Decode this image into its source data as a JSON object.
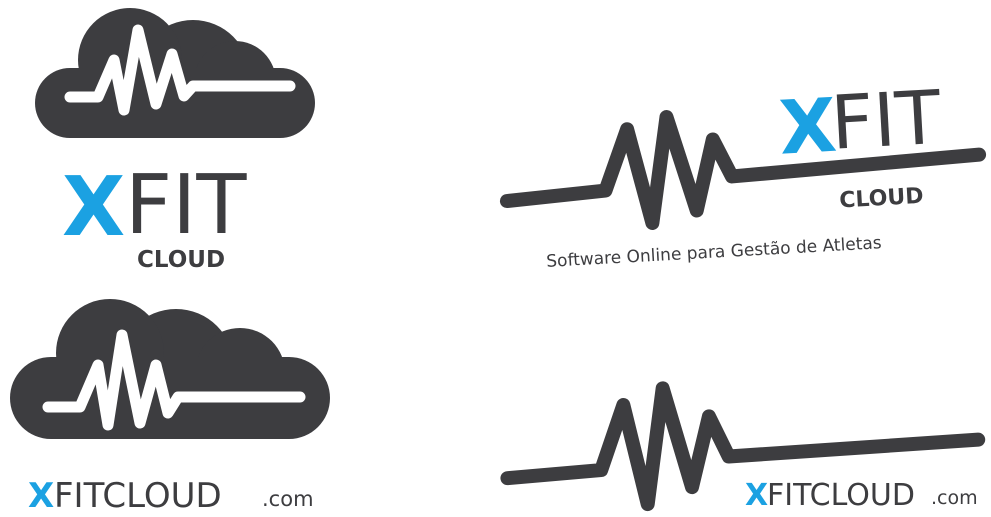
{
  "logos": {
    "stacked": {
      "x_letter": "X",
      "fit": "FIT",
      "cloud": "CLOUD"
    },
    "horizontal": {
      "x_letter": "X",
      "fit": "FIT",
      "cloud": "CLOUD",
      "tagline": "Software Online para Gestão de Atletas"
    },
    "cloud_url": {
      "x_letter": "X",
      "fitcloud": "FITCLOUD",
      "domain": ".com"
    },
    "line_url": {
      "x_letter": "X",
      "fitcloud": "FITCLOUD",
      "domain": ".com"
    }
  },
  "colors": {
    "dark": "#3d3d40",
    "accent": "#1ba1e2",
    "white": "#ffffff"
  }
}
